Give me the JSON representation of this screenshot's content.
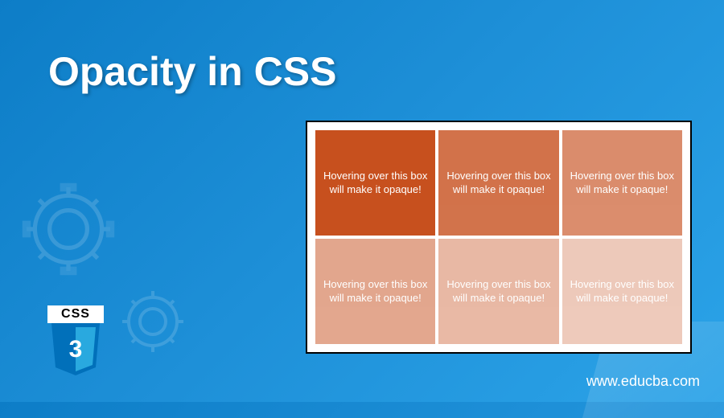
{
  "title": "Opacity in CSS",
  "demo": {
    "box_text": "Hovering over this box will make it opaque!",
    "opacities": [
      1.0,
      0.8,
      0.65,
      0.5,
      0.4,
      0.3
    ]
  },
  "badge": {
    "label": "CSS",
    "number": "3"
  },
  "site_url": "www.educba.com",
  "colors": {
    "bg_gradient_start": "#0d7dc7",
    "bg_gradient_end": "#2ba3e8",
    "box_base": "#c7501e",
    "shield": "#0170ba"
  }
}
